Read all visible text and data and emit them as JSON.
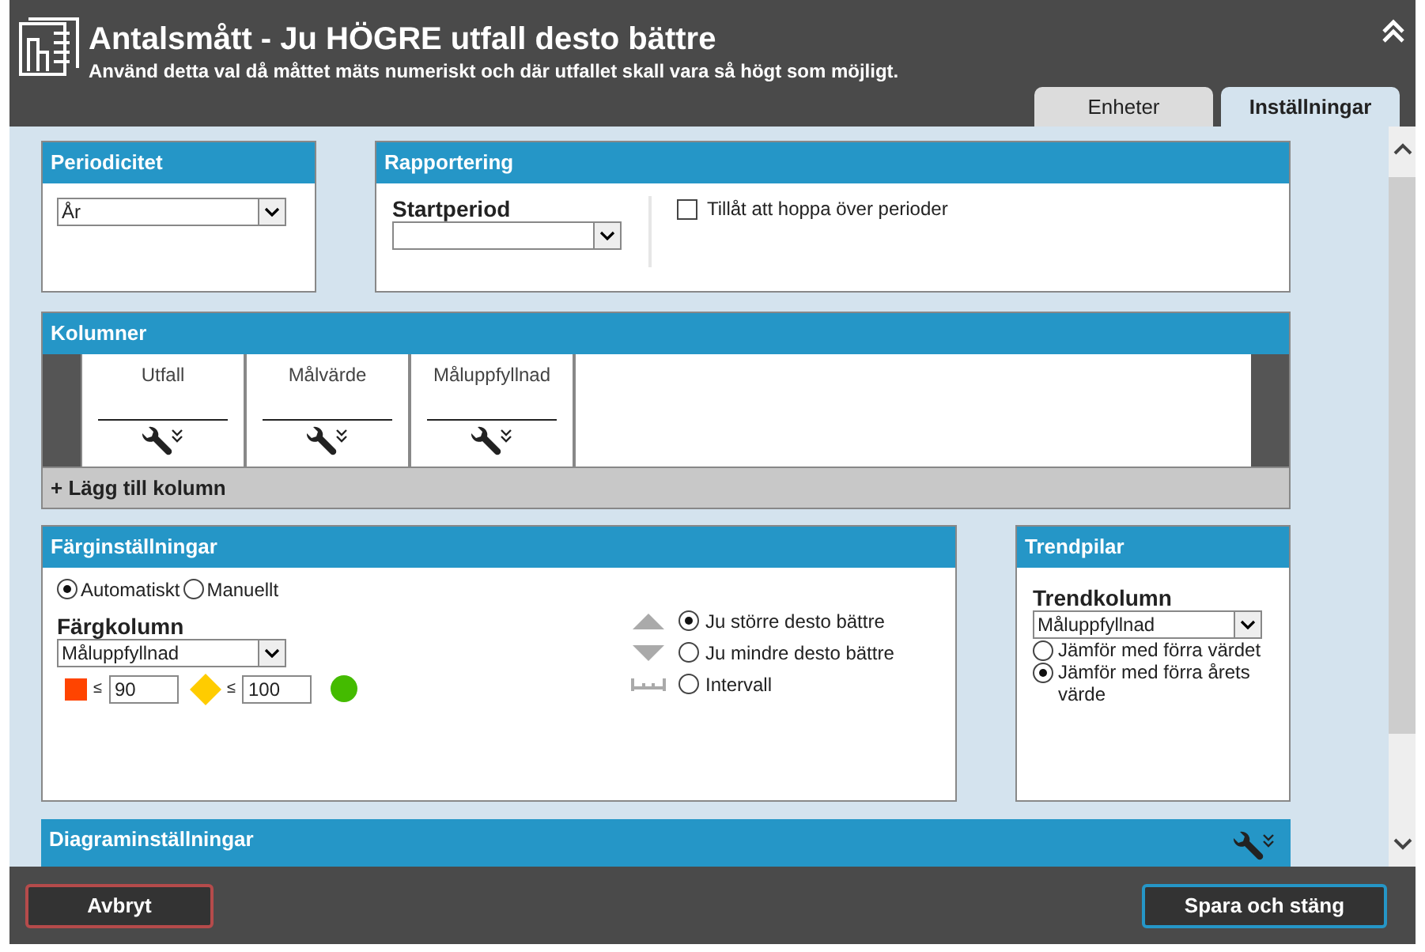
{
  "header": {
    "title": "Antalsmått - Ju HÖGRE utfall desto bättre",
    "subtitle": "Använd detta val då måttet mäts numeriskt och där utfallet skall vara så högt som möjligt."
  },
  "tabs": [
    {
      "label": "Enheter",
      "selected": false
    },
    {
      "label": "Inställningar",
      "selected": true
    }
  ],
  "periodicitet": {
    "title": "Periodicitet",
    "value": "År"
  },
  "rapportering": {
    "title": "Rapportering",
    "field_label": "Startperiod",
    "checkbox": {
      "label": "Tillåt att hoppa över perioder",
      "checked": false
    }
  },
  "kolumner": {
    "title": "Kolumner",
    "columns": [
      {
        "label": "Utfall"
      },
      {
        "label": "Målvärde"
      },
      {
        "label": "Måluppfyllnad"
      }
    ],
    "add_label": "+ Lägg till kolumn"
  },
  "farginstallningar": {
    "title": "Färginställningar",
    "modes": [
      {
        "label": "Automatiskt",
        "selected": true
      },
      {
        "label": "Manuellt",
        "selected": false
      }
    ],
    "field_label": "Färgkolumn",
    "value": "Måluppfyllnad",
    "steps": [
      {
        "kind": "square",
        "color": "#ff4400",
        "sign": "≤",
        "value": "90"
      },
      {
        "kind": "diamond",
        "color": "#ffcc00",
        "sign": "≤",
        "value": "100"
      },
      {
        "kind": "circle",
        "color": "#44bb00"
      }
    ],
    "directions": [
      {
        "kind": "up",
        "label": "Ju större desto bättre",
        "selected": true
      },
      {
        "kind": "down",
        "label": "Ju mindre desto bättre",
        "selected": false
      },
      {
        "kind": "interval",
        "label": "Intervall",
        "selected": false
      }
    ]
  },
  "trendpilar": {
    "title": "Trendpilar",
    "field_label": "Trendkolumn",
    "value": "Måluppfyllnad",
    "options": [
      {
        "label": "Jämför med förra värdet",
        "selected": false
      },
      {
        "label": "Jämför med förra årets värde",
        "selected": true
      }
    ]
  },
  "diagram": {
    "title": "Diagraminställningar"
  },
  "buttons": {
    "cancel": "Avbryt",
    "save": "Spara och stäng"
  }
}
